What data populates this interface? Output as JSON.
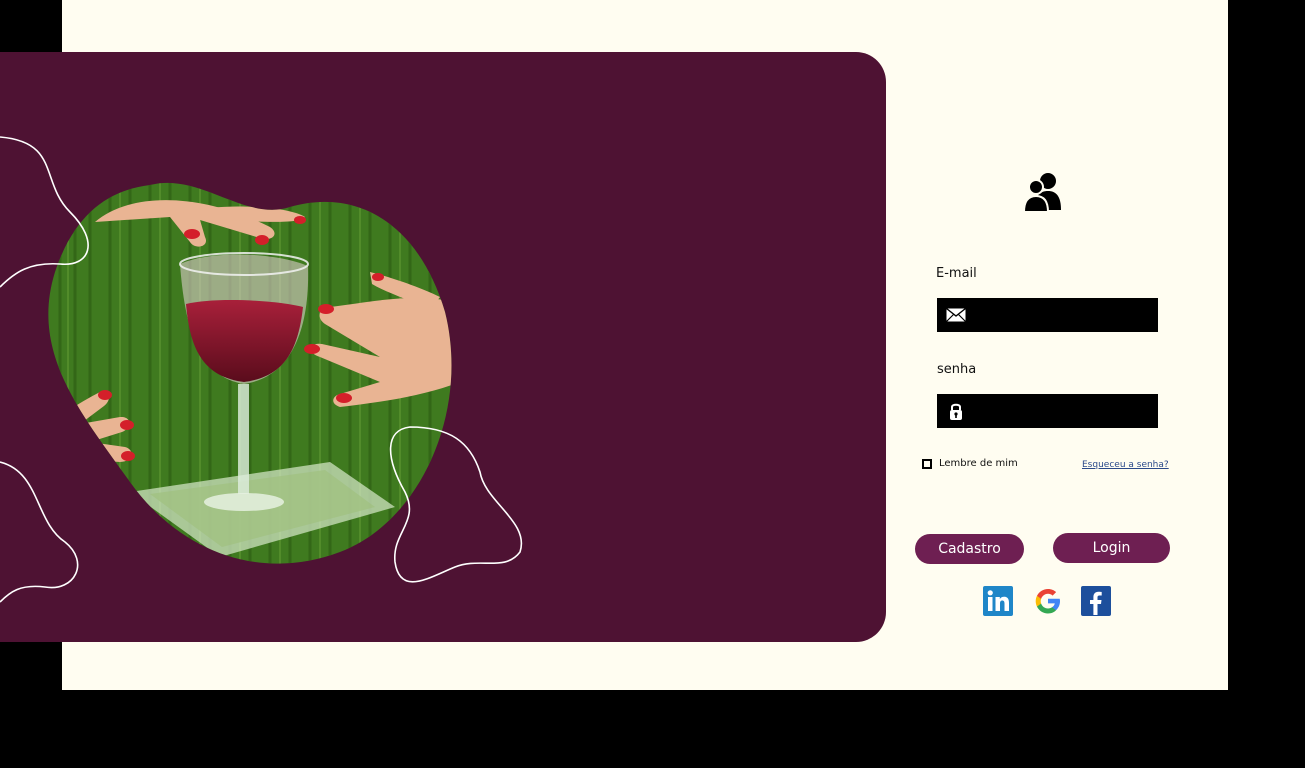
{
  "hero": {
    "image": "woman-hands-wine-glass-photo"
  },
  "login": {
    "user_icon": "users-icon",
    "email": {
      "label": "E-mail",
      "icon": "envelope-icon",
      "value": "",
      "placeholder": ""
    },
    "password": {
      "label": "senha",
      "icon": "lock-icon",
      "value": "",
      "placeholder": ""
    },
    "remember_label": "Lembre de mim",
    "forgot_label": "Esqueceu a senha?",
    "register_label": "Cadastro",
    "login_label": "Login"
  },
  "social": [
    {
      "name": "linkedin",
      "icon": "linkedin-icon"
    },
    {
      "name": "google",
      "icon": "google-icon"
    },
    {
      "name": "facebook",
      "icon": "facebook-icon"
    }
  ],
  "colors": {
    "page_background": "#fffdf1",
    "panel": "#4e1233",
    "button": "#6e1f52",
    "input": "#000000",
    "link": "#2b4a8a"
  }
}
